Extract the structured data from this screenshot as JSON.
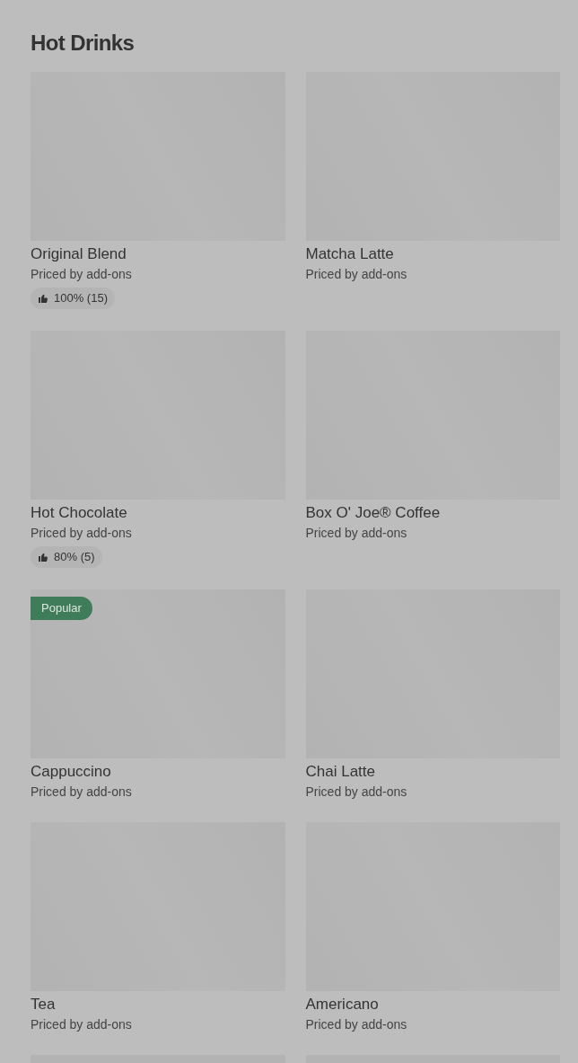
{
  "section": {
    "title": "Hot Drinks"
  },
  "items": [
    {
      "kind": "product",
      "name": "Original Blend",
      "subtitle": "Priced by add-ons",
      "rating": "100% (15)"
    },
    {
      "kind": "product",
      "name": "Matcha Latte",
      "subtitle": "Priced by add-ons"
    },
    {
      "kind": "product",
      "name": "Hot Chocolate",
      "subtitle": "Priced by add-ons",
      "rating": "80% (5)"
    },
    {
      "kind": "product",
      "name": "Box O' Joe® Coffee",
      "subtitle": "Priced by add-ons"
    },
    {
      "kind": "product",
      "name": "Cappuccino",
      "subtitle": "Priced by add-ons",
      "badge": "Popular"
    },
    {
      "kind": "product",
      "name": "Chai Latte",
      "subtitle": "Priced by add-ons"
    },
    {
      "kind": "product",
      "name": "Tea",
      "subtitle": "Priced by add-ons"
    },
    {
      "kind": "product",
      "name": "Americano",
      "subtitle": "Priced by add-ons"
    },
    {
      "kind": "cut"
    },
    {
      "kind": "cut"
    }
  ]
}
